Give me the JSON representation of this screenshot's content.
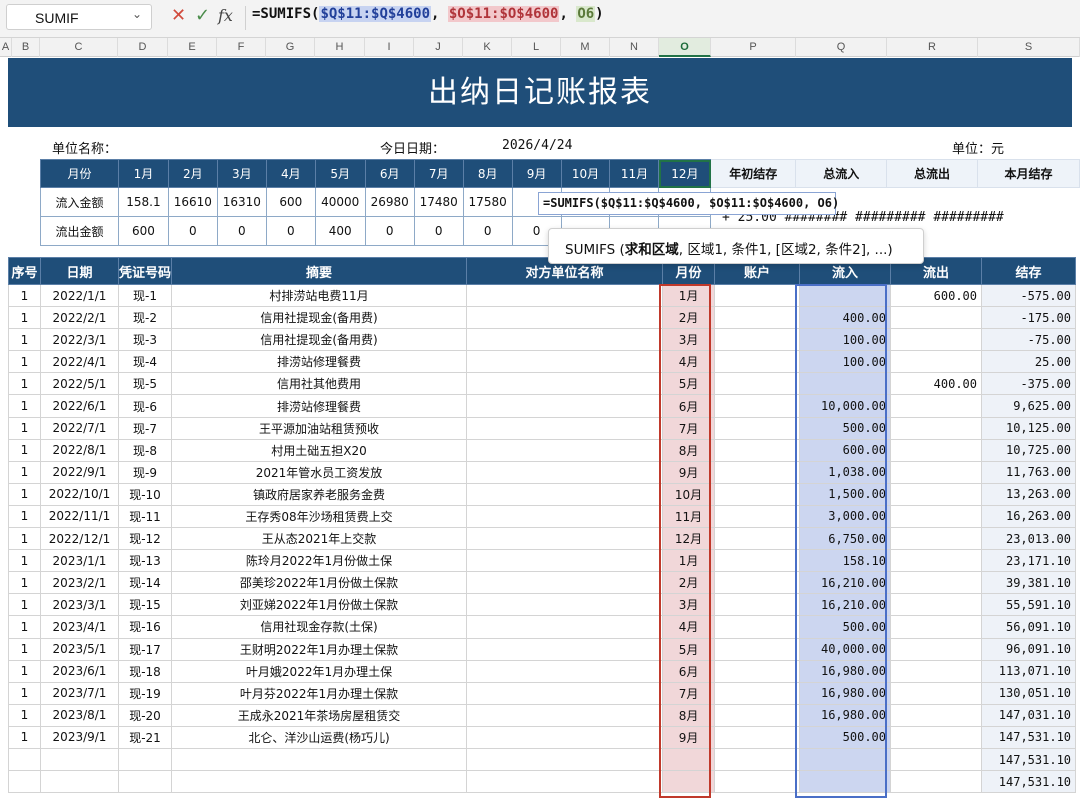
{
  "formula_bar": {
    "name_box": "SUMIF",
    "formula_prefix": "=SUMIFS(",
    "ref1": "$Q$11:$Q$4600",
    "comma1": ", ",
    "ref2": "$O$11:$O$4600",
    "comma2": ", ",
    "ref3": "O6",
    "close": ")"
  },
  "columns": [
    "A",
    "B",
    "C",
    "D",
    "E",
    "F",
    "G",
    "H",
    "I",
    "J",
    "K",
    "L",
    "M",
    "N",
    "O",
    "P",
    "Q",
    "R",
    "S"
  ],
  "title": "出纳日记账报表",
  "info": {
    "unit_name_label": "单位名称：",
    "today_label": "今日日期：",
    "today_value": "2026/4/24",
    "unit_label": "单位：元"
  },
  "summary": {
    "row_header": "月份",
    "months": [
      "1月",
      "2月",
      "3月",
      "4月",
      "5月",
      "6月",
      "7月",
      "8月",
      "9月",
      "10月",
      "11月",
      "12月"
    ],
    "extra_headers": [
      "年初结存",
      "总流入",
      "总流出",
      "本月结存"
    ],
    "inflow_label": "流入金额",
    "inflow_values": [
      "158.1",
      "16610",
      "16310",
      "600",
      "40000",
      "26980",
      "17480",
      "17580",
      "",
      "",
      "",
      ""
    ],
    "outflow_label": "流出金额",
    "outflow_values": [
      "600",
      "0",
      "0",
      "0",
      "400",
      "0",
      "0",
      "0",
      "0",
      "",
      "",
      ""
    ],
    "overflow_text": "+ 25.00 ######## ######### #########"
  },
  "editor_text": "=SUMIFS($Q$11:$Q$4600, $O$11:$O$4600, O6)",
  "tooltip": {
    "fn": "SUMIFS",
    "open": " (",
    "bold_arg": "求和区域",
    "rest": ", 区域1, 条件1, [区域2, 条件2], ...)"
  },
  "main": {
    "headers": [
      "序号",
      "日期",
      "凭证号码",
      "摘要",
      "对方单位名称",
      "月份",
      "账户",
      "流入",
      "流出",
      "结存"
    ],
    "rows": [
      {
        "n": "1",
        "date": "2022/1/1",
        "voucher": "现-1",
        "desc": "村排涝站电费11月",
        "month": "1月",
        "inflow": "",
        "outflow": "600.00",
        "balance": "-575.00"
      },
      {
        "n": "1",
        "date": "2022/2/1",
        "voucher": "现-2",
        "desc": "信用社提现金(备用费)",
        "month": "2月",
        "inflow": "400.00",
        "outflow": "",
        "balance": "-175.00"
      },
      {
        "n": "1",
        "date": "2022/3/1",
        "voucher": "现-3",
        "desc": "信用社提现金(备用费)",
        "month": "3月",
        "inflow": "100.00",
        "outflow": "",
        "balance": "-75.00"
      },
      {
        "n": "1",
        "date": "2022/4/1",
        "voucher": "现-4",
        "desc": "排涝站修理餐费",
        "month": "4月",
        "inflow": "100.00",
        "outflow": "",
        "balance": "25.00"
      },
      {
        "n": "1",
        "date": "2022/5/1",
        "voucher": "现-5",
        "desc": "信用社其他费用",
        "month": "5月",
        "inflow": "",
        "outflow": "400.00",
        "balance": "-375.00"
      },
      {
        "n": "1",
        "date": "2022/6/1",
        "voucher": "现-6",
        "desc": "排涝站修理餐费",
        "month": "6月",
        "inflow": "10,000.00",
        "outflow": "",
        "balance": "9,625.00"
      },
      {
        "n": "1",
        "date": "2022/7/1",
        "voucher": "现-7",
        "desc": "王平源加油站租赁预收",
        "month": "7月",
        "inflow": "500.00",
        "outflow": "",
        "balance": "10,125.00"
      },
      {
        "n": "1",
        "date": "2022/8/1",
        "voucher": "现-8",
        "desc": "村用土础五担X20",
        "month": "8月",
        "inflow": "600.00",
        "outflow": "",
        "balance": "10,725.00"
      },
      {
        "n": "1",
        "date": "2022/9/1",
        "voucher": "现-9",
        "desc": "2021年管水员工资发放",
        "month": "9月",
        "inflow": "1,038.00",
        "outflow": "",
        "balance": "11,763.00"
      },
      {
        "n": "1",
        "date": "2022/10/1",
        "voucher": "现-10",
        "desc": "镇政府居家养老服务金费",
        "month": "10月",
        "inflow": "1,500.00",
        "outflow": "",
        "balance": "13,263.00"
      },
      {
        "n": "1",
        "date": "2022/11/1",
        "voucher": "现-11",
        "desc": "王存秀08年沙场租赁费上交",
        "month": "11月",
        "inflow": "3,000.00",
        "outflow": "",
        "balance": "16,263.00"
      },
      {
        "n": "1",
        "date": "2022/12/1",
        "voucher": "现-12",
        "desc": "王从态2021年上交款",
        "month": "12月",
        "inflow": "6,750.00",
        "outflow": "",
        "balance": "23,013.00"
      },
      {
        "n": "1",
        "date": "2023/1/1",
        "voucher": "现-13",
        "desc": "陈玲月2022年1月份做土保",
        "month": "1月",
        "inflow": "158.10",
        "outflow": "",
        "balance": "23,171.10"
      },
      {
        "n": "1",
        "date": "2023/2/1",
        "voucher": "现-14",
        "desc": "邵美珍2022年1月份做土保款",
        "month": "2月",
        "inflow": "16,210.00",
        "outflow": "",
        "balance": "39,381.10"
      },
      {
        "n": "1",
        "date": "2023/3/1",
        "voucher": "现-15",
        "desc": "刘亚娣2022年1月份做土保款",
        "month": "3月",
        "inflow": "16,210.00",
        "outflow": "",
        "balance": "55,591.10"
      },
      {
        "n": "1",
        "date": "2023/4/1",
        "voucher": "现-16",
        "desc": "信用社现金存款(土保)",
        "month": "4月",
        "inflow": "500.00",
        "outflow": "",
        "balance": "56,091.10"
      },
      {
        "n": "1",
        "date": "2023/5/1",
        "voucher": "现-17",
        "desc": "王财明2022年1月办理土保款",
        "month": "5月",
        "inflow": "40,000.00",
        "outflow": "",
        "balance": "96,091.10"
      },
      {
        "n": "1",
        "date": "2023/6/1",
        "voucher": "现-18",
        "desc": "叶月娥2022年1月办理土保",
        "month": "6月",
        "inflow": "16,980.00",
        "outflow": "",
        "balance": "113,071.10"
      },
      {
        "n": "1",
        "date": "2023/7/1",
        "voucher": "现-19",
        "desc": "叶月芬2022年1月办理土保款",
        "month": "7月",
        "inflow": "16,980.00",
        "outflow": "",
        "balance": "130,051.10"
      },
      {
        "n": "1",
        "date": "2023/8/1",
        "voucher": "现-20",
        "desc": "王成永2021年茶场房屋租赁交",
        "month": "8月",
        "inflow": "16,980.00",
        "outflow": "",
        "balance": "147,031.10"
      },
      {
        "n": "1",
        "date": "2023/9/1",
        "voucher": "现-21",
        "desc": "北仑、洋沙山运费(杨巧儿)",
        "month": "9月",
        "inflow": "500.00",
        "outflow": "",
        "balance": "147,531.10"
      },
      {
        "n": "",
        "date": "",
        "voucher": "",
        "desc": "",
        "month": "",
        "inflow": "",
        "outflow": "",
        "balance": "147,531.10"
      },
      {
        "n": "",
        "date": "",
        "voucher": "",
        "desc": "",
        "month": "",
        "inflow": "",
        "outflow": "",
        "balance": "147,531.10"
      }
    ]
  },
  "colors": {
    "header_blue": "#1f4e79",
    "excel_green": "#217346",
    "month_highlight": "#f1d7d9",
    "inflow_highlight": "#ccd6f0"
  }
}
